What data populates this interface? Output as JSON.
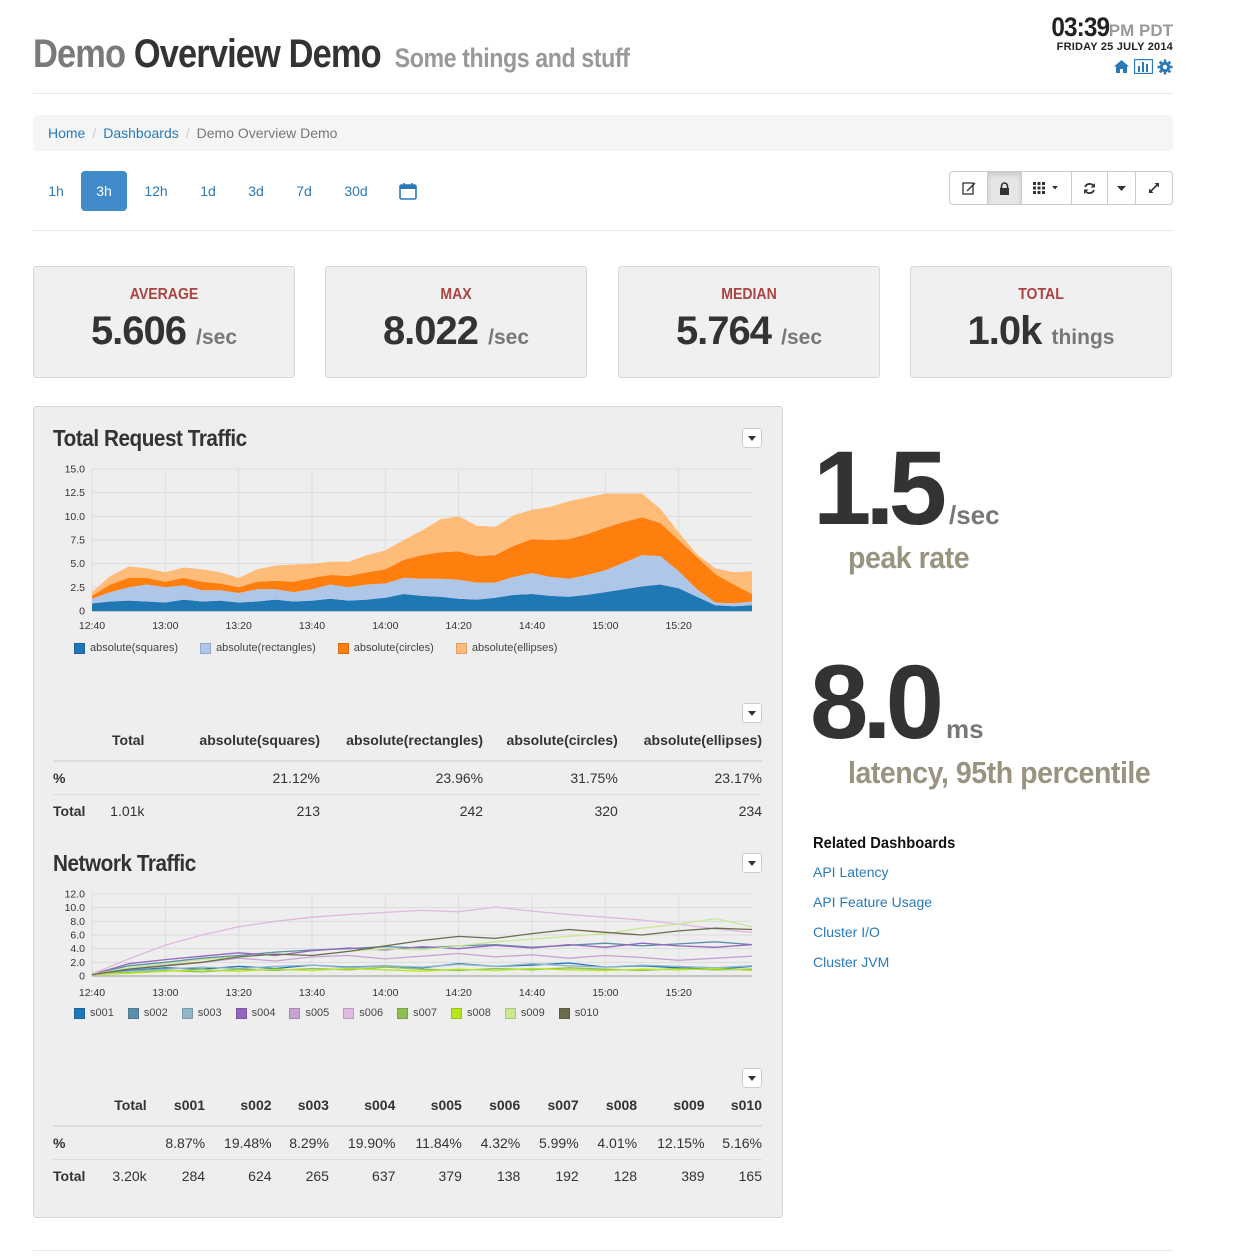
{
  "header": {
    "title_part1": "Demo",
    "title_part2": "Overview Demo",
    "subtitle": "Some things and stuff"
  },
  "clock": {
    "time": "03:39",
    "ampm": "PM PDT",
    "date": "FRIDAY 25 JULY 2014"
  },
  "header_icons": [
    "home-icon",
    "chart-icon",
    "gear-icon"
  ],
  "breadcrumb": {
    "home": "Home",
    "dashboards": "Dashboards",
    "current": "Demo Overview Demo"
  },
  "time_ranges": [
    "1h",
    "3h",
    "12h",
    "1d",
    "3d",
    "7d",
    "30d"
  ],
  "active_time_range": "3h",
  "toolbar_icons": [
    "edit-icon",
    "lock-icon",
    "grid-icon",
    "refresh-icon",
    "caret-down-icon",
    "fullscreen-icon"
  ],
  "stats": [
    {
      "label": "AVERAGE",
      "value": "5.606",
      "unit": "/sec"
    },
    {
      "label": "MAX",
      "value": "8.022",
      "unit": "/sec"
    },
    {
      "label": "MEDIAN",
      "value": "5.764",
      "unit": "/sec"
    },
    {
      "label": "TOTAL",
      "value": "1.0k",
      "unit": "things"
    }
  ],
  "traffic_panel": {
    "title": "Total Request Traffic",
    "table": {
      "headers": [
        "",
        "Total",
        "absolute(squares)",
        "absolute(rectangles)",
        "absolute(circles)",
        "absolute(ellipses)"
      ],
      "rows": [
        [
          "%",
          "",
          "21.12%",
          "23.96%",
          "31.75%",
          "23.17%"
        ],
        [
          "Total",
          "1.01k",
          "213",
          "242",
          "320",
          "234"
        ]
      ]
    }
  },
  "network_panel": {
    "title": "Network Traffic",
    "table": {
      "headers": [
        "",
        "Total",
        "s001",
        "s002",
        "s003",
        "s004",
        "s005",
        "s006",
        "s007",
        "s008",
        "s009",
        "s010"
      ],
      "rows": [
        [
          "%",
          "",
          "8.87%",
          "19.48%",
          "8.29%",
          "19.90%",
          "11.84%",
          "4.32%",
          "5.99%",
          "4.01%",
          "12.15%",
          "5.16%"
        ],
        [
          "Total",
          "3.20k",
          "284",
          "624",
          "265",
          "637",
          "379",
          "138",
          "192",
          "128",
          "389",
          "165"
        ]
      ]
    }
  },
  "singlestats": [
    {
      "value": "1.5",
      "unit": "/sec",
      "description": "peak rate"
    },
    {
      "value": "8.0",
      "unit": "ms",
      "description": "latency, 95th percentile"
    }
  ],
  "related": {
    "title": "Related Dashboards",
    "links": [
      "API Latency",
      "API Feature Usage",
      "Cluster I/O",
      "Cluster JVM"
    ]
  },
  "chart_data": [
    {
      "type": "area",
      "stacked": true,
      "title": "Total Request Traffic",
      "x_ticks": [
        "12:40",
        "13:00",
        "13:20",
        "13:40",
        "14:00",
        "14:20",
        "14:40",
        "15:00",
        "15:20"
      ],
      "x_minutes": [
        0,
        5,
        10,
        15,
        20,
        25,
        30,
        35,
        40,
        45,
        50,
        55,
        60,
        65,
        70,
        75,
        80,
        85,
        90,
        95,
        100,
        105,
        110,
        115,
        120,
        125,
        130,
        135,
        140,
        145,
        150,
        155,
        160,
        165,
        170,
        175,
        180
      ],
      "x_start": "12:40",
      "ylim": [
        0,
        15
      ],
      "y_ticks": [
        "0",
        "2.5",
        "5.0",
        "7.5",
        "10.0",
        "12.5",
        "15.0"
      ],
      "series": [
        {
          "name": "absolute(squares)",
          "color": "#1f77b4",
          "values": [
            0.8,
            1.0,
            1.1,
            1.0,
            0.9,
            1.2,
            1.0,
            1.1,
            0.9,
            1.0,
            1.2,
            1.0,
            1.1,
            1.3,
            1.1,
            1.2,
            1.4,
            1.8,
            1.6,
            1.5,
            1.3,
            1.2,
            1.4,
            1.7,
            1.8,
            1.6,
            1.5,
            1.7,
            2.0,
            2.3,
            2.6,
            2.8,
            2.4,
            1.5,
            0.6,
            0.5,
            0.6
          ]
        },
        {
          "name": "absolute(rectangles)",
          "color": "#aec7e8",
          "values": [
            0.5,
            1.0,
            1.4,
            1.8,
            1.6,
            1.5,
            1.2,
            1.1,
            1.0,
            1.3,
            1.1,
            1.0,
            1.2,
            1.5,
            1.4,
            1.6,
            1.5,
            1.7,
            1.8,
            1.9,
            2.0,
            1.8,
            1.6,
            1.9,
            2.2,
            2.0,
            1.9,
            2.1,
            2.3,
            2.8,
            3.3,
            3.0,
            1.8,
            0.8,
            0.3,
            0.3,
            0.4
          ]
        },
        {
          "name": "absolute(circles)",
          "color": "#ff7f0e",
          "values": [
            0.3,
            0.8,
            1.0,
            0.7,
            0.6,
            0.8,
            0.9,
            0.7,
            0.6,
            0.8,
            0.9,
            1.1,
            1.2,
            1.0,
            1.2,
            1.3,
            1.5,
            1.9,
            2.5,
            2.8,
            3.0,
            2.8,
            2.9,
            3.3,
            3.6,
            3.9,
            4.2,
            4.3,
            4.5,
            4.3,
            4.0,
            3.5,
            3.3,
            3.4,
            3.0,
            2.0,
            0.8
          ]
        },
        {
          "name": "absolute(ellipses)",
          "color": "#ffbb78",
          "values": [
            0.4,
            0.9,
            1.2,
            1.0,
            1.0,
            1.1,
            1.3,
            1.2,
            1.0,
            1.3,
            1.6,
            1.8,
            1.5,
            1.4,
            1.5,
            1.8,
            2.0,
            2.1,
            2.6,
            3.5,
            3.7,
            3.2,
            3.0,
            3.2,
            3.1,
            3.5,
            4.0,
            3.9,
            3.6,
            3.0,
            2.5,
            1.5,
            0.8,
            0.3,
            0.6,
            1.3,
            2.4
          ]
        }
      ],
      "legend_position": "bottom"
    },
    {
      "type": "line",
      "title": "Network Traffic",
      "x_ticks": [
        "12:40",
        "13:00",
        "13:20",
        "13:40",
        "14:00",
        "14:20",
        "14:40",
        "15:00",
        "15:20"
      ],
      "x_minutes": [
        0,
        10,
        20,
        30,
        40,
        50,
        60,
        70,
        80,
        90,
        100,
        110,
        120,
        130,
        140,
        150,
        160,
        170,
        180
      ],
      "x_start": "12:40",
      "ylim": [
        0,
        12
      ],
      "y_ticks": [
        "0",
        "2.0",
        "4.0",
        "6.0",
        "8.0",
        "10.0",
        "12.0"
      ],
      "series": [
        {
          "name": "s001",
          "color": "#1f77b4",
          "values": [
            0.2,
            0.8,
            1.2,
            1.0,
            1.4,
            1.1,
            1.6,
            1.3,
            1.5,
            1.2,
            1.8,
            1.4,
            1.6,
            1.9,
            1.3,
            1.5,
            1.2,
            1.0,
            1.4
          ]
        },
        {
          "name": "s002",
          "color": "#5b8fa8",
          "values": [
            0.3,
            1.5,
            2.0,
            2.6,
            3.0,
            3.5,
            3.8,
            4.0,
            4.3,
            4.1,
            4.4,
            4.6,
            4.2,
            4.5,
            4.8,
            4.4,
            4.7,
            5.0,
            4.6
          ]
        },
        {
          "name": "s003",
          "color": "#91b7c9",
          "values": [
            0.2,
            0.7,
            1.0,
            1.3,
            1.1,
            1.4,
            1.6,
            1.2,
            1.5,
            1.3,
            1.7,
            1.4,
            1.8,
            1.5,
            1.3,
            1.6,
            1.4,
            1.2,
            1.5
          ]
        },
        {
          "name": "s004",
          "color": "#9467bd",
          "values": [
            0.2,
            1.8,
            2.4,
            2.9,
            3.4,
            3.0,
            3.7,
            4.1,
            3.8,
            4.3,
            4.0,
            4.5,
            4.1,
            4.6,
            4.2,
            4.8,
            4.4,
            4.2,
            4.6
          ]
        },
        {
          "name": "s005",
          "color": "#c5a3d4",
          "values": [
            0.3,
            1.0,
            1.6,
            2.0,
            2.6,
            2.2,
            2.8,
            3.0,
            2.5,
            2.9,
            3.3,
            2.8,
            3.1,
            2.6,
            3.0,
            2.7,
            2.3,
            2.6,
            2.9
          ]
        },
        {
          "name": "s006",
          "color": "#e0b8e0",
          "values": [
            0.3,
            2.5,
            4.5,
            6.0,
            7.2,
            8.0,
            8.6,
            9.0,
            9.3,
            9.6,
            9.4,
            10.1,
            9.5,
            9.0,
            8.6,
            8.2,
            7.6,
            6.9,
            6.4
          ]
        },
        {
          "name": "s007",
          "color": "#8cc152",
          "values": [
            0.2,
            0.5,
            0.8,
            0.6,
            1.0,
            0.8,
            1.1,
            0.9,
            1.3,
            1.0,
            0.8,
            1.1,
            0.9,
            1.2,
            1.0,
            0.8,
            1.1,
            0.9,
            1.0
          ]
        },
        {
          "name": "s008",
          "color": "#b5e61d",
          "values": [
            0.2,
            0.4,
            0.7,
            0.9,
            0.7,
            1.0,
            0.8,
            1.1,
            0.9,
            0.7,
            1.0,
            0.8,
            1.1,
            0.9,
            0.8,
            1.0,
            0.9,
            1.1,
            0.8
          ]
        },
        {
          "name": "s009",
          "color": "#c9e891",
          "values": [
            0.2,
            1.2,
            1.8,
            2.4,
            2.8,
            3.2,
            3.0,
            3.6,
            4.0,
            3.8,
            4.4,
            5.0,
            5.4,
            5.8,
            6.2,
            7.0,
            7.6,
            8.4,
            7.2
          ]
        },
        {
          "name": "s010",
          "color": "#6b6b4e",
          "values": [
            0.2,
            1.0,
            1.5,
            2.0,
            2.8,
            3.2,
            3.0,
            3.6,
            4.4,
            5.2,
            5.8,
            5.5,
            6.2,
            6.8,
            6.4,
            6.0,
            6.6,
            7.0,
            6.8
          ]
        }
      ],
      "legend_position": "bottom"
    }
  ]
}
